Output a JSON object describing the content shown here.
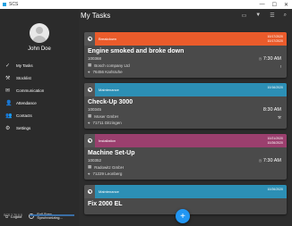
{
  "window": {
    "title": "SCS",
    "minimize": "—",
    "maximize": "☐",
    "close": "✕"
  },
  "user": {
    "name": "John Doe"
  },
  "nav": [
    {
      "icon": "check",
      "label": "My Tasks"
    },
    {
      "icon": "wrench",
      "label": "Stocklist"
    },
    {
      "icon": "chat",
      "label": "Communication"
    },
    {
      "icon": "user",
      "label": "Attendance"
    },
    {
      "icon": "people",
      "label": "Contacts"
    },
    {
      "icon": "gear",
      "label": "Settings"
    }
  ],
  "footer": {
    "logout": "Logout",
    "sync_title": "Full Sync",
    "sync_status": "Synchronizing...",
    "version": "SCS 2.70.0.0",
    "sync_progress": 1.0
  },
  "main": {
    "title": "My Tasks"
  },
  "tasks": [
    {
      "category": "Breakdown",
      "color": "#ea5b2b",
      "date1": "10/17/2020",
      "date2": "10/17/2020",
      "title": "Engine smoked and broke down",
      "number": "100368",
      "company": "Bosch company Ltd",
      "address": "76456 Karlsruhe",
      "time": "7:30 AM"
    },
    {
      "category": "Maintenance",
      "color": "#2c8fb5",
      "date1": "10/16/2020",
      "date2": "",
      "title": "Check-Up 3000",
      "number": "100345",
      "company": "Moser GmbH",
      "address": "71711 Ditzingen",
      "time": "8:30 AM"
    },
    {
      "category": "Installation",
      "color": "#9b3f6e",
      "date1": "10/21/2020",
      "date2": "10/26/2020",
      "title": "Machine Set-Up",
      "number": "100352",
      "company": "Radowitz GmbH",
      "address": "71229 Leonberg",
      "time": "7:30 AM"
    },
    {
      "category": "Maintenance",
      "color": "#2c8fb5",
      "date1": "10/26/2020",
      "date2": "",
      "title": "Fix 2000 EL",
      "number": "",
      "company": "",
      "address": "",
      "time": ""
    }
  ]
}
